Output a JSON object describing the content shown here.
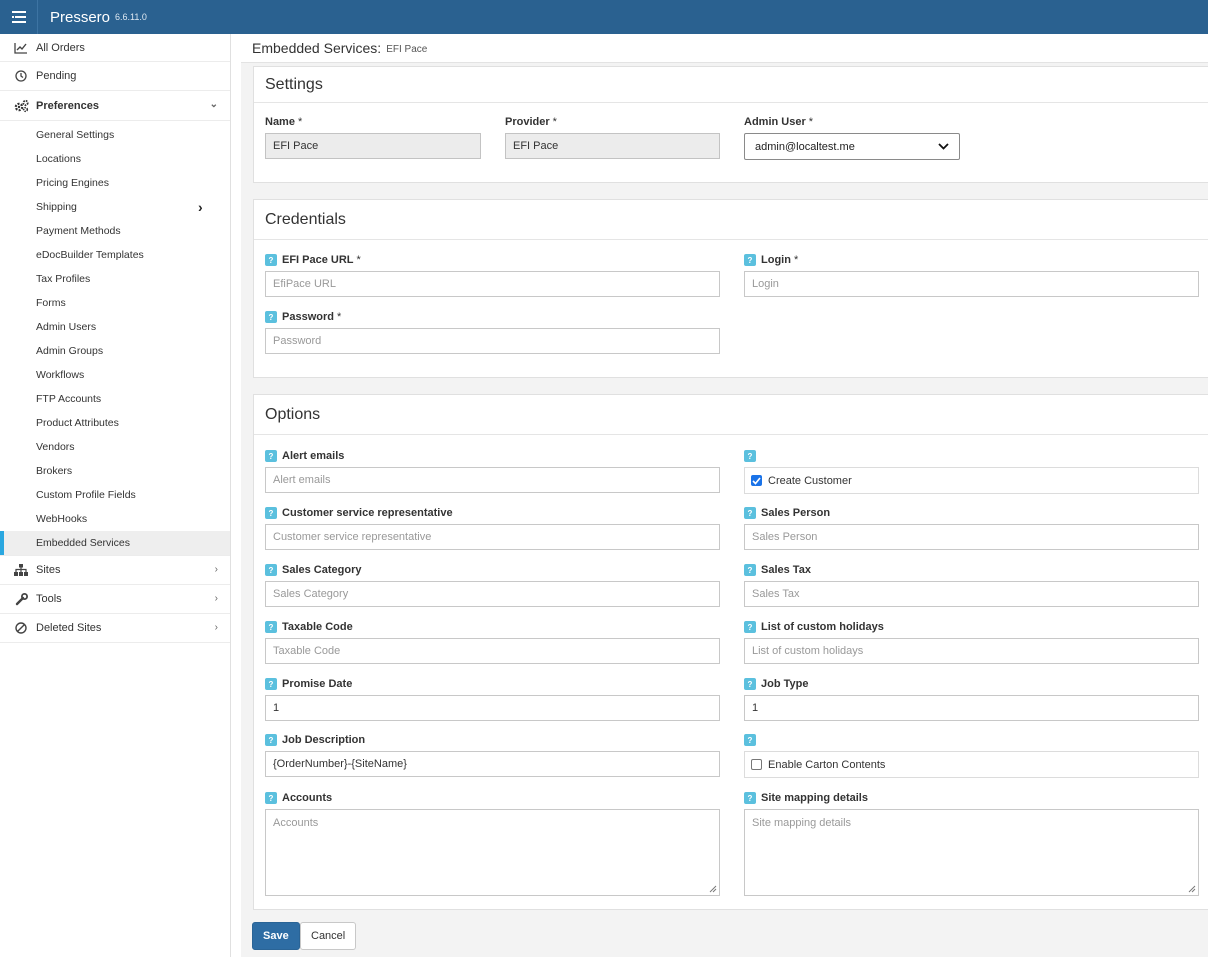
{
  "app": {
    "name": "Pressero",
    "version": "6.6.11.0"
  },
  "sidebar": {
    "top_items": [
      {
        "label": "All Orders",
        "icon": "chart-line-icon"
      },
      {
        "label": "Pending",
        "icon": "clock-icon"
      },
      {
        "label": "Preferences",
        "icon": "gears-icon"
      }
    ],
    "sub_items": [
      {
        "label": "General Settings"
      },
      {
        "label": "Locations"
      },
      {
        "label": "Pricing Engines"
      },
      {
        "label": "Shipping"
      },
      {
        "label": "Payment Methods"
      },
      {
        "label": "eDocBuilder Templates"
      },
      {
        "label": "Tax Profiles"
      },
      {
        "label": "Forms"
      },
      {
        "label": "Admin Users"
      },
      {
        "label": "Admin Groups"
      },
      {
        "label": "Workflows"
      },
      {
        "label": "FTP Accounts"
      },
      {
        "label": "Product Attributes"
      },
      {
        "label": "Vendors"
      },
      {
        "label": "Brokers"
      },
      {
        "label": "Custom Profile Fields"
      },
      {
        "label": "WebHooks"
      },
      {
        "label": "Embedded Services"
      }
    ],
    "bottom_items": [
      {
        "label": "Sites",
        "icon": "sitemap-icon"
      },
      {
        "label": "Tools",
        "icon": "wrench-icon"
      },
      {
        "label": "Deleted Sites",
        "icon": "ban-icon"
      }
    ],
    "active_item": "Embedded Services"
  },
  "page": {
    "title": "Embedded Services:",
    "subtitle": "EFI Pace"
  },
  "settings": {
    "title": "Settings",
    "name_label": "Name",
    "name_value": "EFI Pace",
    "provider_label": "Provider",
    "provider_value": "EFI Pace",
    "admin_user_label": "Admin User",
    "admin_user_value": "admin@localtest.me"
  },
  "credentials": {
    "title": "Credentials",
    "url_label": "EFI Pace URL",
    "url_placeholder": "EfiPace URL",
    "login_label": "Login",
    "login_placeholder": "Login",
    "password_label": "Password",
    "password_placeholder": "Password"
  },
  "options": {
    "title": "Options",
    "alert_emails_label": "Alert emails",
    "alert_emails_placeholder": "Alert emails",
    "create_customer_label": "Create Customer",
    "create_customer_checked": true,
    "csr_label": "Customer service representative",
    "csr_placeholder": "Customer service representative",
    "sales_person_label": "Sales Person",
    "sales_person_placeholder": "Sales Person",
    "sales_category_label": "Sales Category",
    "sales_category_placeholder": "Sales Category",
    "sales_tax_label": "Sales Tax",
    "sales_tax_placeholder": "Sales Tax",
    "taxable_code_label": "Taxable Code",
    "taxable_code_placeholder": "Taxable Code",
    "holidays_label": "List of custom holidays",
    "holidays_placeholder": "List of custom holidays",
    "promise_date_label": "Promise Date",
    "promise_date_value": "1",
    "job_type_label": "Job Type",
    "job_type_value": "1",
    "job_description_label": "Job Description",
    "job_description_value": "{OrderNumber}-{SiteName}",
    "carton_contents_label": "Enable Carton Contents",
    "carton_contents_checked": false,
    "accounts_label": "Accounts",
    "accounts_placeholder": "Accounts",
    "site_mapping_label": "Site mapping details",
    "site_mapping_placeholder": "Site mapping details"
  },
  "common": {
    "required_mark": "*",
    "help_mark": "?"
  },
  "actions": {
    "save_label": "Save",
    "cancel_label": "Cancel"
  },
  "colors": {
    "topbar": "#2a6190",
    "active_accent": "#2aa7e0",
    "help_badge": "#5bc0de",
    "primary_button": "#2e6da4"
  }
}
